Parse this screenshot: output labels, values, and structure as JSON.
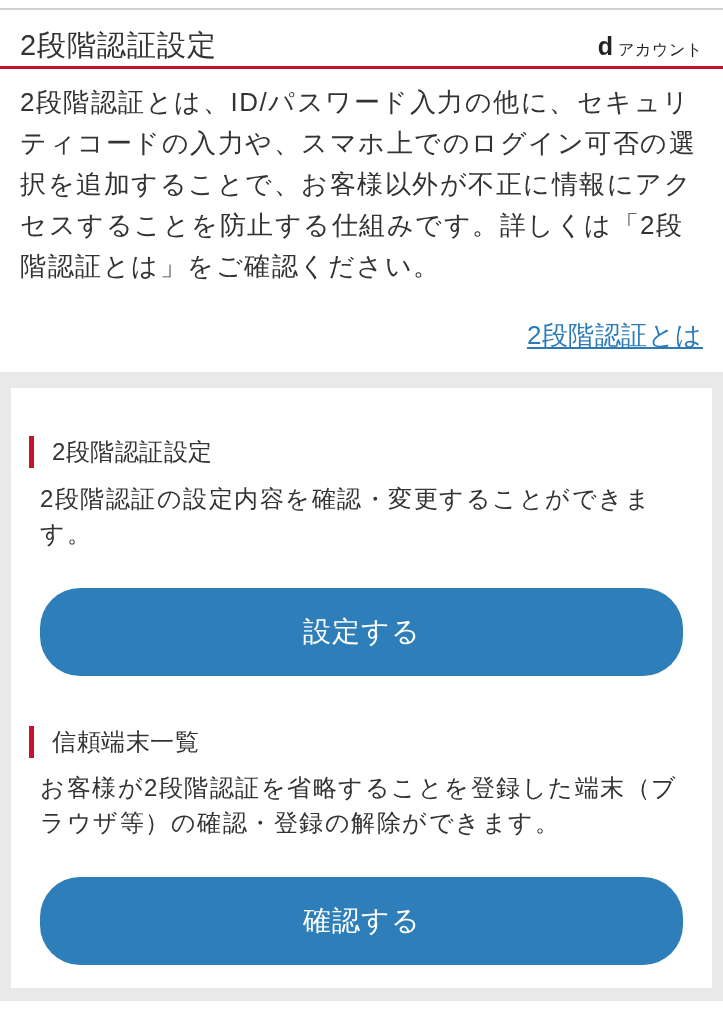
{
  "header": {
    "title": "2段階認証設定",
    "logo": {
      "mark": "d",
      "text": "アカウント"
    }
  },
  "intro": {
    "text": "2段階認証とは、ID/パスワード入力の他に、セキュリティコードの入力や、スマホ上でのログイン可否の選択を追加することで、お客様以外が不正に情報にアクセスすることを防止する仕組みです。詳しくは「2段階認証とは」をご確認ください。",
    "link": "2段階認証とは"
  },
  "sections": [
    {
      "heading": "2段階認証設定",
      "description": "2段階認証の設定内容を確認・変更することができます。",
      "button": "設定する"
    },
    {
      "heading": "信頼端末一覧",
      "description": "お客様が2段階認証を省略することを登録した端末（ブラウザ等）の確認・登録の解除ができます。",
      "button": "確認する"
    }
  ]
}
